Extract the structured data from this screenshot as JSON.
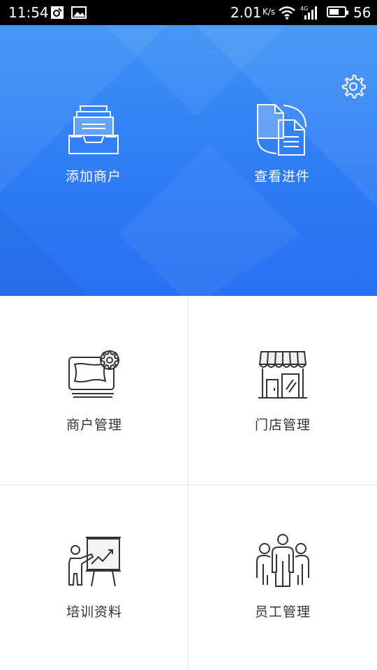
{
  "status_bar": {
    "time": "11:54",
    "net_speed": "2.01",
    "net_speed_unit": "K/s",
    "battery_level": "56",
    "icons": [
      "notification-icon",
      "image-icon",
      "wifi-icon",
      "4g-signal-icon",
      "battery-icon"
    ]
  },
  "header": {
    "settings_icon": "gear-icon",
    "actions": [
      {
        "label": "添加商户",
        "icon": "tray-stack-icon"
      },
      {
        "label": "查看进件",
        "icon": "documents-icon"
      }
    ]
  },
  "grid": [
    {
      "label": "商户管理",
      "icon": "monitor-gear-icon"
    },
    {
      "label": "门店管理",
      "icon": "storefront-icon"
    },
    {
      "label": "培训资料",
      "icon": "presentation-icon"
    },
    {
      "label": "员工管理",
      "icon": "people-group-icon"
    }
  ],
  "colors": {
    "header_top": "#3d92f5",
    "header_bottom": "#2a70f3",
    "icon_stroke": "#333333",
    "divider": "#e6e6e6"
  }
}
